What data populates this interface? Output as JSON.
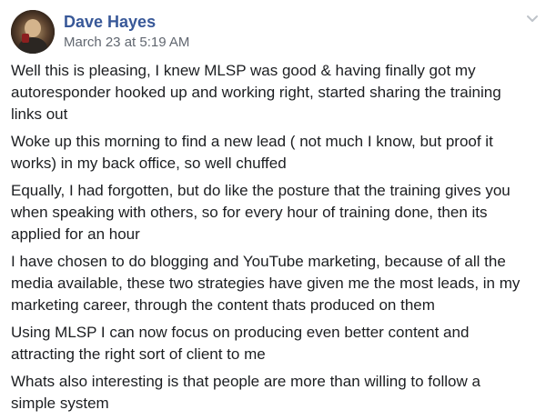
{
  "post": {
    "author": "Dave Hayes",
    "timestamp": "March 23 at 5:19 AM",
    "icons": {
      "avatar": "profile-photo",
      "menu": "chevron-down-icon"
    },
    "colors": {
      "author_link": "#385898",
      "meta_text": "#616770",
      "body_text": "#1c1e21"
    },
    "paragraphs": [
      "Well this is pleasing, I knew MLSP was good & having finally got my\nautoresponder hooked up and working right, started sharing the training\nlinks out",
      "Woke up this morning to find a new lead ( not much I know, but proof it\nworks) in my back office, so well chuffed",
      "Equally, I had forgotten, but do like the posture that the training gives you\nwhen speaking with others, so for every hour of training done, then its\napplied for an hour",
      "I have chosen to do blogging and YouTube marketing, because of all the\nmedia available, these two strategies have given me the most leads, in my\nmarketing career, through the content thats produced on them",
      "Using MLSP I can now focus on producing even better content and\nattracting the right sort of client to me",
      "Whats also interesting is that people are more than willing to follow a\nsimple system"
    ]
  }
}
